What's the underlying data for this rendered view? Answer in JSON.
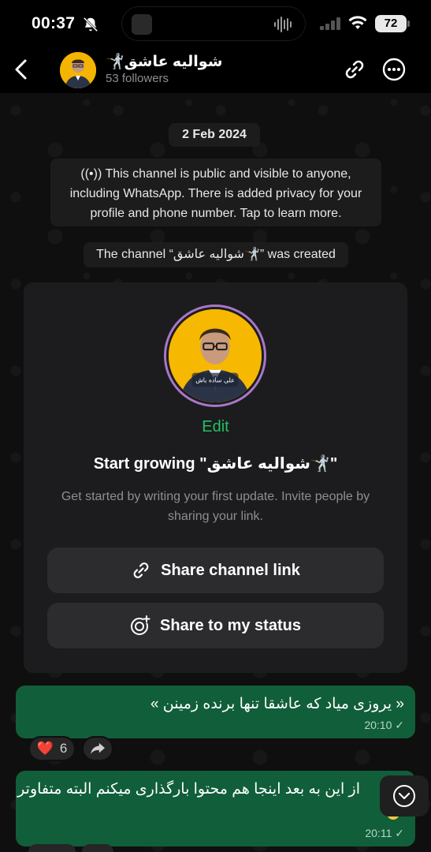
{
  "status_bar": {
    "time": "00:37",
    "battery": "72"
  },
  "header": {
    "channel_name": "شوالیه عاشق🤺",
    "followers": "53 followers"
  },
  "chat": {
    "date": "2 Feb 2024",
    "privacy_notice": "This channel is public and visible to anyone, including WhatsApp. There is added privacy for your profile and phone number. Tap to learn more.",
    "created_notice": "The channel “شوالیه عاشق🤺” was created"
  },
  "card": {
    "edit_label": "Edit",
    "title": "Start growing \"شوالیه عاشق🤺\"",
    "description": "Get started by writing your first update. Invite people by sharing your link.",
    "share_link_label": "Share channel link",
    "share_status_label": "Share to my status"
  },
  "messages": [
    {
      "text": "« یروزی میاد که عاشقا تنها برنده زمینن »",
      "time": "20:10 ✓"
    },
    {
      "text": "از این به بعد اینجا هم محتوا بارگذاری میکنم البته متفاوتر",
      "time": "20:11 ✓"
    }
  ],
  "reaction": {
    "emoji": "❤️",
    "count": "6"
  },
  "colors": {
    "accent_green": "#21c063",
    "bubble_green": "#115e3a",
    "avatar_ring": "#a777c9"
  }
}
